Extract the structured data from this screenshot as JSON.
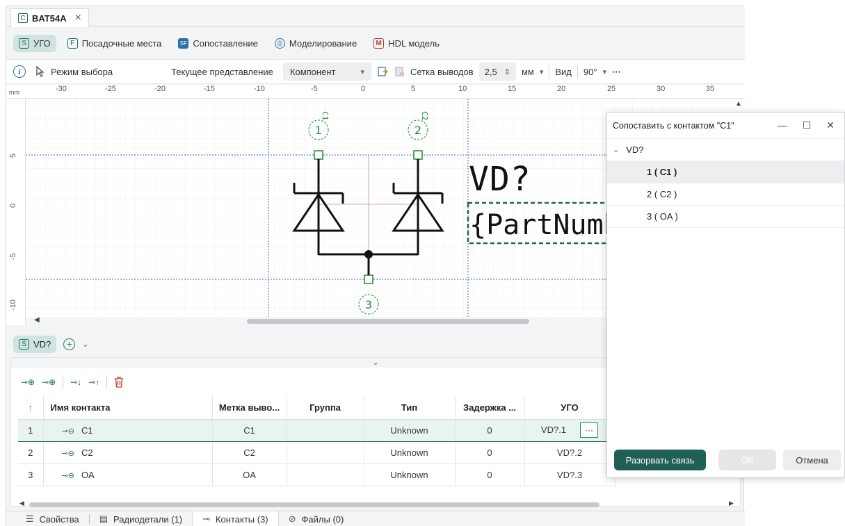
{
  "document": {
    "tab_icon": "C",
    "tab_title": "BAT54A",
    "close": "×"
  },
  "editor_tabs": [
    {
      "icon": "S",
      "label": "УГО",
      "active": true
    },
    {
      "icon": "F",
      "label": "Посадочные места"
    },
    {
      "icon": "SF",
      "label": "Сопоставление"
    },
    {
      "icon": "◎",
      "label": "Моделирование"
    },
    {
      "icon": "M",
      "label": "HDL модель"
    }
  ],
  "toolbar": {
    "info": "i",
    "mode": "Режим выбора",
    "view_label": "Текущее представление",
    "view_value": "Компонент",
    "grid_label": "Сетка выводов",
    "grid_value": "2,5",
    "unit": "мм",
    "view": "Вид",
    "rotation": "90°",
    "more": "···"
  },
  "ruler": {
    "unit": "mm",
    "x_ticks": [
      "-30",
      "-25",
      "-20",
      "-15",
      "-10",
      "-5",
      "0",
      "5",
      "10",
      "15",
      "20",
      "25",
      "30",
      "35"
    ],
    "y_ticks": [
      "5",
      "0",
      "-5",
      "-10"
    ]
  },
  "schematic": {
    "designator": "VD?",
    "part_number": "{PartNumber}",
    "pins": [
      "1",
      "2",
      "3"
    ],
    "pin_labels": [
      "C1",
      "C2"
    ],
    "colors": {
      "pin": "#1f8a2c",
      "guide": "#3b5bdb",
      "body": "#111111"
    }
  },
  "symbol_bar": {
    "icon": "S",
    "label": "VD?"
  },
  "contacts": {
    "columns": [
      "Имя контакта",
      "Метка выво...",
      "Группа",
      "Тип",
      "Задержка ...",
      "УГО"
    ],
    "sort_arrow": "↑",
    "rows": [
      {
        "n": "1",
        "name": "C1",
        "label": "C1",
        "group": "",
        "type": "Unknown",
        "delay": "0",
        "ugo": "VD?.1"
      },
      {
        "n": "2",
        "name": "C2",
        "label": "C2",
        "group": "",
        "type": "Unknown",
        "delay": "0",
        "ugo": "VD?.2"
      },
      {
        "n": "3",
        "name": "OA",
        "label": "OA",
        "group": "",
        "type": "Unknown",
        "delay": "0",
        "ugo": "VD?.3"
      }
    ],
    "dots": "···"
  },
  "bottom_tabs": [
    {
      "label": "Свойства"
    },
    {
      "label": "Радиодетали (1)"
    },
    {
      "label": "Контакты (3)",
      "active": true
    },
    {
      "label": "Файлы (0)"
    }
  ],
  "dialog": {
    "title": "Сопоставить с контактом \"C1\"",
    "root": "VD?",
    "items": [
      "1 ( C1 )",
      "2 ( C2 )",
      "3 ( OA )"
    ],
    "btn_unlink": "Разорвать связь",
    "btn_ok": "OK",
    "btn_cancel": "Отмена"
  }
}
